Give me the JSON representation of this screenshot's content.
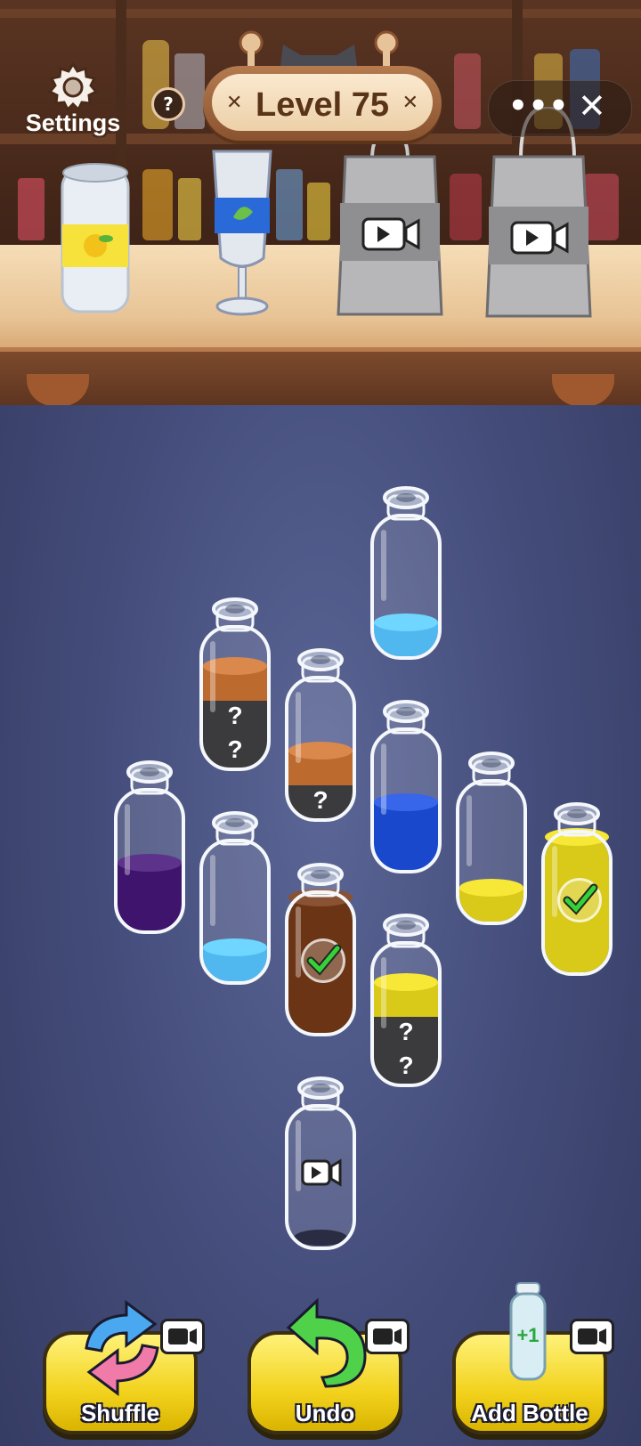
{
  "header": {
    "settings_label": "Settings",
    "help_label": "?",
    "level_label": "Level 75",
    "more_label": "•••",
    "close_label": "✕"
  },
  "shop_items": [
    {
      "name": "lemon-soda-can",
      "locked": false
    },
    {
      "name": "leaf-goblet",
      "locked": false
    },
    {
      "name": "gift-bag-1",
      "locked": true
    },
    {
      "name": "gift-bag-2",
      "locked": true
    }
  ],
  "bottles": [
    {
      "id": 1,
      "layers": [
        {
          "color": "#50b8ee",
          "hidden": false
        }
      ],
      "complete": false
    },
    {
      "id": 2,
      "layers": [
        {
          "color": "#3b3b3e",
          "hidden": true
        },
        {
          "color": "#3b3b3e",
          "hidden": true
        },
        {
          "color": "#bd6a2e",
          "hidden": false
        }
      ],
      "complete": false
    },
    {
      "id": 3,
      "layers": [
        {
          "color": "#3b3b3e",
          "hidden": true
        },
        {
          "color": "#bd6a2e",
          "hidden": false
        }
      ],
      "complete": false
    },
    {
      "id": 4,
      "layers": [
        {
          "color": "#1948cc",
          "hidden": false
        },
        {
          "color": "#1948cc",
          "hidden": false
        }
      ],
      "complete": false
    },
    {
      "id": 5,
      "layers": [
        {
          "color": "#d9c918",
          "hidden": false
        }
      ],
      "complete": false
    },
    {
      "id": 6,
      "layers": [
        {
          "color": "#3f146c",
          "hidden": false
        },
        {
          "color": "#3f146c",
          "hidden": false
        }
      ],
      "complete": false
    },
    {
      "id": 7,
      "layers": [
        {
          "color": "#50b8ee",
          "hidden": false
        }
      ],
      "complete": false
    },
    {
      "id": 8,
      "layers": [
        {
          "color": "#6b3414",
          "hidden": false
        },
        {
          "color": "#6b3414",
          "hidden": false
        },
        {
          "color": "#6b3414",
          "hidden": false
        },
        {
          "color": "#6b3414",
          "hidden": false
        }
      ],
      "complete": true
    },
    {
      "id": 9,
      "layers": [
        {
          "color": "#d9c918",
          "hidden": false
        },
        {
          "color": "#d9c918",
          "hidden": false
        },
        {
          "color": "#d9c918",
          "hidden": false
        },
        {
          "color": "#d9c918",
          "hidden": false
        }
      ],
      "complete": true
    },
    {
      "id": 10,
      "layers": [
        {
          "color": "#3b3b3e",
          "hidden": true
        },
        {
          "color": "#3b3b3e",
          "hidden": true
        },
        {
          "color": "#d9c918",
          "hidden": false
        }
      ],
      "complete": false
    },
    {
      "id": 11,
      "layers": [],
      "complete": false,
      "locked": true
    }
  ],
  "question_mark": "?",
  "actions": {
    "shuffle_label": "Shuffle",
    "undo_label": "Undo",
    "add_bottle_label": "Add Bottle",
    "add_bottle_badge": "+1"
  },
  "colors": {
    "accent_yellow": "#f2d21d",
    "complete_red": "#e4202a"
  }
}
